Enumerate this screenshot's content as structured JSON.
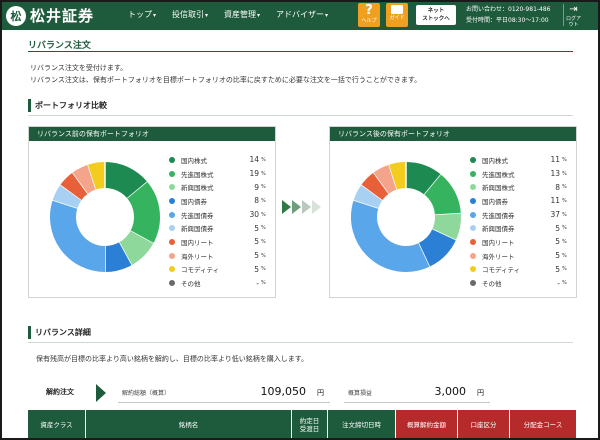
{
  "header": {
    "logo_mark": "松",
    "brand": "松井証券",
    "nav": [
      "トップ",
      "投信取引",
      "資産管理",
      "アドバイザー"
    ],
    "help_label": "ヘルプ",
    "guide_label": "ガイド",
    "netstock_line1": "ネット",
    "netstock_line2": "ストックへ",
    "contact_line1": "お問い合わせ：0120-981-486",
    "contact_line2": "受付時間：平日08:30～17:00",
    "logout_label": "ログアウト"
  },
  "page": {
    "title": "リバランス注文",
    "intro1": "リバランス注文を受付けます。",
    "intro2": "リバランス注文は、保有ポートフォリオを目標ポートフォリオの比率に戻すために必要な注文を一括で行うことができます。"
  },
  "comparison": {
    "section_title": "ポートフォリオ比較",
    "unit": "%",
    "before": {
      "title": "リバランス前の保有ポートフォリオ",
      "items": [
        {
          "name": "国内株式",
          "value": "14",
          "pct": 14,
          "color": "#1d8a52"
        },
        {
          "name": "先進国株式",
          "value": "19",
          "pct": 19,
          "color": "#35b35e"
        },
        {
          "name": "新興国株式",
          "value": "9",
          "pct": 9,
          "color": "#8fd89c"
        },
        {
          "name": "国内債券",
          "value": "8",
          "pct": 8,
          "color": "#2b7fd4"
        },
        {
          "name": "先進国債券",
          "value": "30",
          "pct": 30,
          "color": "#5aa6ea"
        },
        {
          "name": "新興国債券",
          "value": "5",
          "pct": 5,
          "color": "#a7d0f3"
        },
        {
          "name": "国内リート",
          "value": "5",
          "pct": 5,
          "color": "#e8603a"
        },
        {
          "name": "海外リート",
          "value": "5",
          "pct": 5,
          "color": "#f4a48a"
        },
        {
          "name": "コモディティ",
          "value": "5",
          "pct": 5,
          "color": "#f3cc1f"
        },
        {
          "name": "その他",
          "value": "-",
          "pct": 0,
          "color": "#6a6a6a"
        }
      ]
    },
    "after": {
      "title": "リバランス後の保有ポートフォリオ",
      "items": [
        {
          "name": "国内株式",
          "value": "11",
          "pct": 11,
          "color": "#1d8a52"
        },
        {
          "name": "先進国株式",
          "value": "13",
          "pct": 13,
          "color": "#35b35e"
        },
        {
          "name": "新興国株式",
          "value": "8",
          "pct": 8,
          "color": "#8fd89c"
        },
        {
          "name": "国内債券",
          "value": "11",
          "pct": 11,
          "color": "#2b7fd4"
        },
        {
          "name": "先進国債券",
          "value": "37",
          "pct": 37,
          "color": "#5aa6ea"
        },
        {
          "name": "新興国債券",
          "value": "5",
          "pct": 5,
          "color": "#a7d0f3"
        },
        {
          "name": "国内リート",
          "value": "5",
          "pct": 5,
          "color": "#e8603a"
        },
        {
          "name": "海外リート",
          "value": "5",
          "pct": 5,
          "color": "#f4a48a"
        },
        {
          "name": "コモディティ",
          "value": "5",
          "pct": 5,
          "color": "#f3cc1f"
        },
        {
          "name": "その他",
          "value": "-",
          "pct": 0,
          "color": "#6a6a6a"
        }
      ]
    }
  },
  "details": {
    "section_title": "リバランス詳細",
    "description": "保有残高が目標の比率より高い銘柄を解約し、目標の比率より低い銘柄を購入します。",
    "order_label": "解約注文",
    "total_label": "解約総額（概算）",
    "total_value": "109,050",
    "total_unit": "円",
    "cash_label": "概算損益",
    "cash_value": "3,000",
    "cash_unit": "円",
    "columns": [
      "資産クラス",
      "銘柄名",
      "約定日\n受渡日",
      "注文締切日時",
      "概算解約金額",
      "口座区分",
      "分配金コース"
    ]
  }
}
